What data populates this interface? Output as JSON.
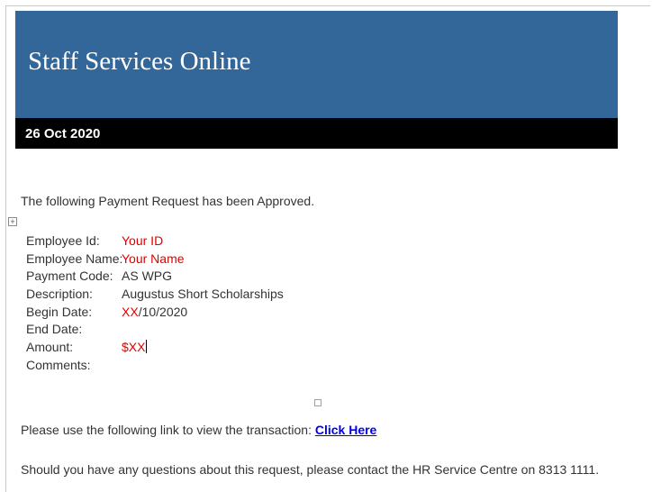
{
  "header": {
    "title": "Staff Services Online",
    "date": "26 Oct 2020"
  },
  "intro": "The following Payment Request has been Approved.",
  "details": {
    "employee_id": {
      "label": "Employee Id:",
      "value": "Your ID"
    },
    "employee_name": {
      "label": "Employee Name:",
      "value": "Your Name"
    },
    "payment_code": {
      "label": "Payment Code:",
      "value": "AS WPG"
    },
    "description": {
      "label": "Description:",
      "value": "Augustus Short Scholarships"
    },
    "begin_date": {
      "label": "Begin Date:",
      "value_highlight": "XX",
      "value_rest": "/10/2020"
    },
    "end_date": {
      "label": "End Date:",
      "value": ""
    },
    "amount": {
      "label": "Amount:",
      "value": "$XX"
    },
    "comments": {
      "label": "Comments:",
      "value": ""
    }
  },
  "link_line": {
    "text": "Please use the following link to view the transaction: ",
    "link_label": "Click Here"
  },
  "contact": "Should you have any questions about this request, please contact the HR Service Centre on 8313 1111.",
  "colors": {
    "banner": "#336699",
    "date_bar": "#000000",
    "highlight": "#e00000",
    "link": "#0000ee"
  }
}
